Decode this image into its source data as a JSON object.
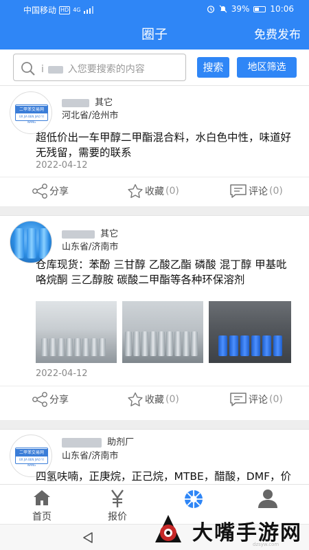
{
  "status_bar": {
    "carrier": "中国移动",
    "hd": "HD",
    "signal": "4G",
    "battery": "39%",
    "time": "10:06"
  },
  "header": {
    "title": "圈子",
    "publish_label": "免费发布"
  },
  "search": {
    "placeholder_prefix": "i",
    "placeholder": "入您要搜索的内容",
    "search_button": "搜索",
    "region_button": "地区筛选"
  },
  "posts": [
    {
      "avatar_text": "二甲苯交易网",
      "avatar_sub": "ER JIA BEN JIAO YI WANG",
      "category": "其它",
      "location": "河北省/沧州市",
      "content": "超低价出一车甲醇二甲酯混合料，水白色中性，味道好无残留，需要的联系",
      "date": "2022-04-12",
      "share": "分享",
      "favorite": "收藏",
      "favorite_count": "(0)",
      "comment": "评论",
      "comment_count": "(0)"
    },
    {
      "category": "其它",
      "location": "山东省/济南市",
      "content": "仓库现货：苯酚 三甘醇 乙酸乙酯 磷酸 混丁醇 甲基吡咯烷酮 三乙醇胺 碳酸二甲酯等各种环保溶剂",
      "date": "2022-04-12",
      "share": "分享",
      "favorite": "收藏",
      "favorite_count": "(0)",
      "comment": "评论",
      "comment_count": "(0)"
    },
    {
      "avatar_text": "二甲苯交易网",
      "avatar_sub": "ER JIA BEN JIAO YI WANG",
      "category": "助剂厂",
      "location": "山东省/济南市",
      "content": "四氢呋喃，正庚烷，正己烷，MTBE，醋酸，DMF，价优"
    }
  ],
  "bottom_nav": [
    {
      "label": "首页",
      "icon": "home-icon"
    },
    {
      "label": "报价",
      "icon": "yen-icon"
    },
    {
      "label": "",
      "icon": "aperture-icon"
    },
    {
      "label": "",
      "icon": "user-icon"
    }
  ],
  "watermark": {
    "text": "大嘴手游网",
    "url": "dzsyw.com"
  },
  "colors": {
    "primary": "#2f86f6",
    "background": "#eeeeee"
  }
}
